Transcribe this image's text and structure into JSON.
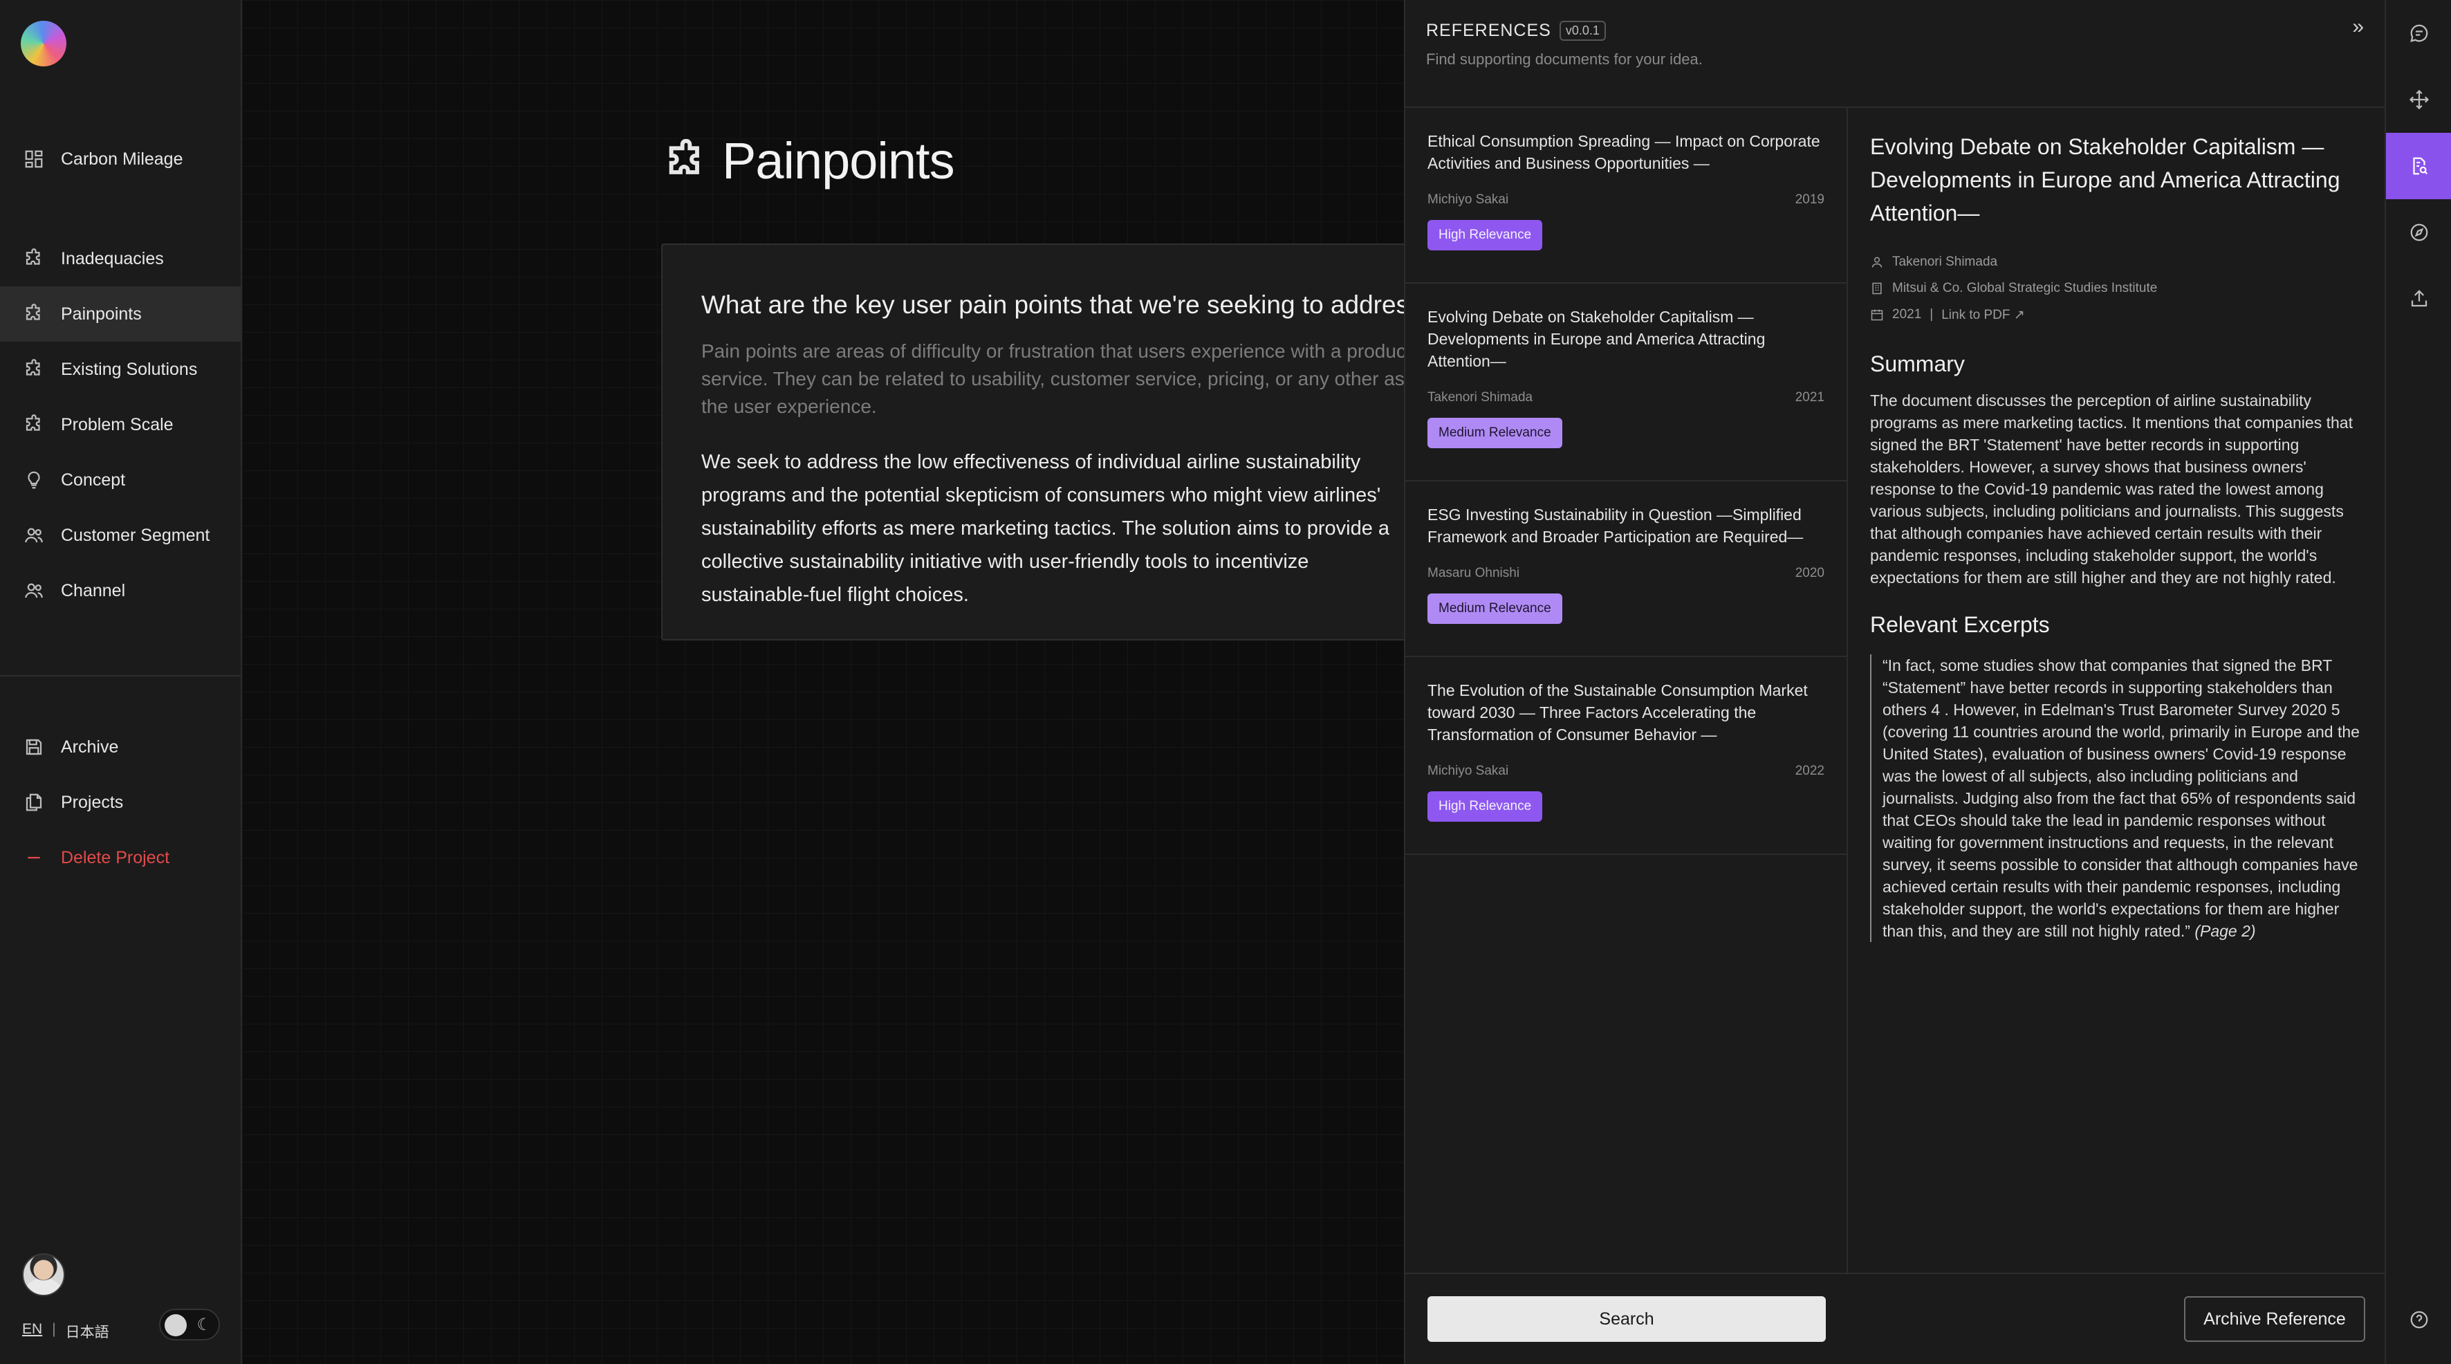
{
  "sidebar": {
    "items": [
      {
        "label": "Carbon Mileage",
        "icon": "dashboard-icon"
      },
      {
        "label": "Inadequacies",
        "icon": "puzzle-icon"
      },
      {
        "label": "Painpoints",
        "icon": "puzzle-icon",
        "active": true
      },
      {
        "label": "Existing Solutions",
        "icon": "puzzle-icon"
      },
      {
        "label": "Problem Scale",
        "icon": "puzzle-icon"
      },
      {
        "label": "Concept",
        "icon": "lightbulb-icon"
      },
      {
        "label": "Customer Segment",
        "icon": "users-icon"
      },
      {
        "label": "Channel",
        "icon": "users-icon"
      }
    ],
    "footer_items": [
      {
        "label": "Archive",
        "icon": "save-icon"
      },
      {
        "label": "Projects",
        "icon": "documents-icon"
      },
      {
        "label": "Delete Project",
        "icon": "minus-icon"
      }
    ],
    "lang": {
      "en": "EN",
      "sep": "|",
      "ja": "日本語"
    }
  },
  "main": {
    "title": "Painpoints",
    "question": "What are the key user pain points that we're seeking to address?",
    "hint": "Pain points are areas of difficulty or frustration that users experience with a product or service. They can be related to usability, customer service, pricing, or any other aspect of the user experience.",
    "answer": "We seek to address the low effectiveness of individual airline sustainability programs and the potential skepticism of consumers who might view airlines' sustainability efforts as mere marketing tactics. The solution aims to provide a collective sustainability initiative with user-friendly tools to incentivize sustainable-fuel flight choices."
  },
  "references": {
    "title": "REFERENCES",
    "version": "v0.0.1",
    "subtitle": "Find supporting documents for your idea.",
    "items": [
      {
        "title": "Ethical Consumption Spreading — Impact on Corporate Activities and Business Opportunities —",
        "author": "Michiyo Sakai",
        "year": "2019",
        "relevance": "High Relevance"
      },
      {
        "title": "Evolving Debate on Stakeholder Capitalism — Developments in Europe and America Attracting Attention—",
        "author": "Takenori Shimada",
        "year": "2021",
        "relevance": "Medium Relevance"
      },
      {
        "title": "ESG Investing Sustainability in Question —Simplified Framework and Broader Participation are Required—",
        "author": "Masaru Ohnishi",
        "year": "2020",
        "relevance": "Medium Relevance"
      },
      {
        "title": "The Evolution of the Sustainable Consumption Market toward 2030 — Three Factors Accelerating the Transformation of Consumer Behavior —",
        "author": "Michiyo Sakai",
        "year": "2022",
        "relevance": "High Relevance"
      }
    ],
    "detail": {
      "title": "Evolving Debate on Stakeholder Capitalism — Developments in Europe and America Attracting Attention—",
      "author": "Takenori Shimada",
      "institute": "Mitsui & Co. Global Strategic Studies Institute",
      "year": "2021",
      "sep": "|",
      "pdf_link": "Link to PDF ↗",
      "summary_heading": "Summary",
      "summary": "The document discusses the perception of airline sustainability programs as mere marketing tactics. It mentions that companies that signed the BRT 'Statement' have better records in supporting stakeholders. However, a survey shows that business owners' response to the Covid-19 pandemic was rated the lowest among various subjects, including politicians and journalists. This suggests that although companies have achieved certain results with their pandemic responses, including stakeholder support, the world's expectations for them are still higher and they are not highly rated.",
      "excerpts_heading": "Relevant Excerpts",
      "excerpt": "“In fact, some studies show that companies that signed the BRT “Statement” have better records in supporting stakeholders than others 4 . However, in Edelman's Trust Barometer Survey 2020 5 (covering 11 countries around the world, primarily in Europe and the United States), evaluation of business owners' Covid-19 response was the lowest of all subjects, also including politicians and journalists. Judging also from the fact that 65% of respondents said that CEOs should take the lead in pandemic responses without waiting for government instructions and requests, in the relevant survey, it seems possible to consider that although companies have achieved certain results with their pandemic responses, including stakeholder support, the world's expectations for them are higher than this, and they are still not highly rated.”",
      "excerpt_page": "(Page 2)"
    },
    "search_label": "Search",
    "archive_label": "Archive Reference"
  },
  "colors": {
    "accent": "#8a52ec",
    "high_relevance": "#8e58f0",
    "medium_relevance": "#b08af4",
    "danger": "#e24a4a"
  }
}
